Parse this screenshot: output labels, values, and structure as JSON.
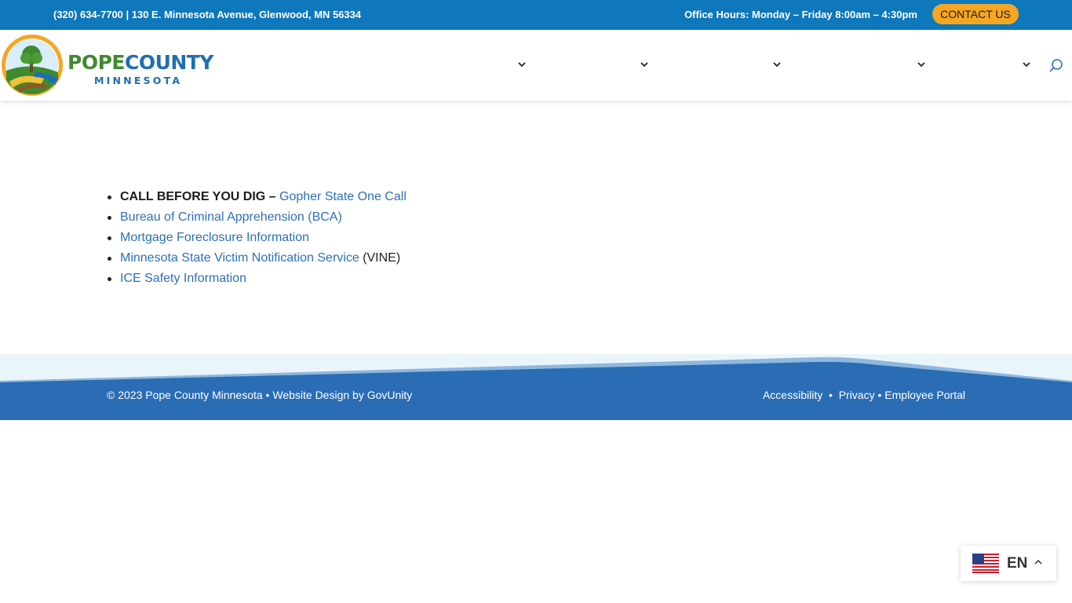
{
  "topbar": {
    "contact_line": "(320) 634-7700 | 130 E. Minnesota Avenue, Glenwood, MN 56334",
    "hours": "Office Hours: Monday – Friday 8:00am – 4:30pm",
    "contact_button": "CONTACT US"
  },
  "logo": {
    "pope": "POPE",
    "county": "COUNTY",
    "state": "MINNESOTA"
  },
  "nav": {
    "chevrons": [
      "chevron-down-icon",
      "chevron-down-icon",
      "chevron-down-icon",
      "chevron-down-icon",
      "chevron-down-icon"
    ],
    "search_icon": "search-icon"
  },
  "content": {
    "items": [
      {
        "prefix": "CALL BEFORE YOU DIG – ",
        "link": "Gopher State One Call",
        "suffix": ""
      },
      {
        "prefix": "",
        "link": "Bureau of Criminal Apprehension (BCA)",
        "suffix": ""
      },
      {
        "prefix": "",
        "link": "Mortgage Foreclosure Information",
        "suffix": ""
      },
      {
        "prefix": "",
        "link": "Minnesota State Victim Notification Service",
        "suffix": " (VINE)"
      },
      {
        "prefix": "",
        "link": "ICE Safety Information",
        "suffix": ""
      }
    ]
  },
  "footer": {
    "copyright": "© 2023 Pope County Minnesota",
    "separator": " • ",
    "design_credit": "Website Design by GovUnity",
    "accessibility": "Accessibility",
    "dot": "  •  ",
    "privacy": "Privacy",
    "dot2": " • ",
    "employee_portal": "Employee Portal"
  },
  "language": {
    "code": "EN",
    "flag_icon": "us-flag-icon",
    "caret_icon": "chevron-up-icon"
  },
  "colors": {
    "topbar_bg": "#0f77bb",
    "contact_button_bg": "#f5a623",
    "link": "#2e6fba",
    "footer_bg": "#2a6db5",
    "footer_light": "#eaf5fb",
    "logo_green": "#3e8a2e",
    "logo_blue": "#1e6fb0"
  }
}
